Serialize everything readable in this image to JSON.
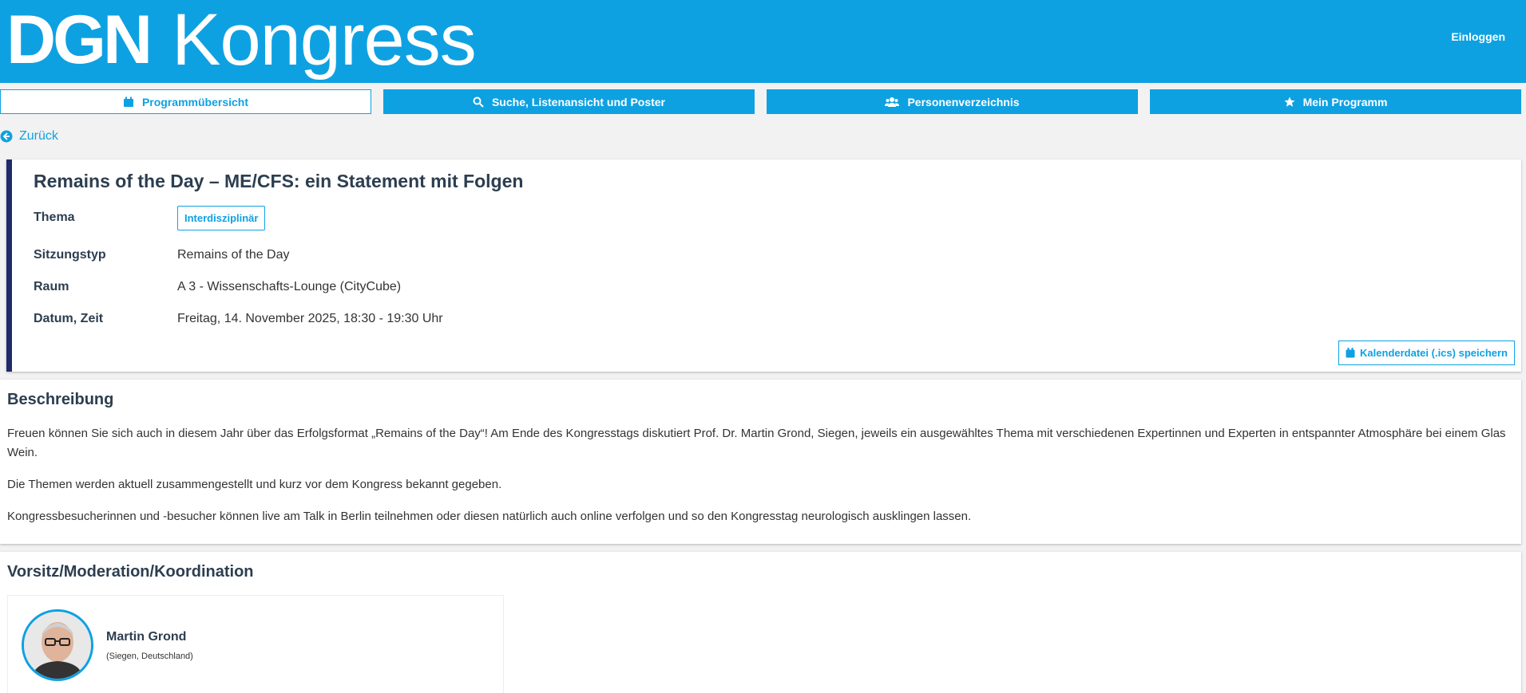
{
  "header": {
    "logo_dgn": "DGN",
    "logo_kongress": "Kongress",
    "login_label": "Einloggen"
  },
  "nav": {
    "items": [
      {
        "label": "Programmübersicht",
        "icon": "calendar-icon",
        "active": true
      },
      {
        "label": "Suche, Listenansicht und Poster",
        "icon": "search-icon",
        "active": false
      },
      {
        "label": "Personenverzeichnis",
        "icon": "users-icon",
        "active": false
      },
      {
        "label": "Mein Programm",
        "icon": "star-icon",
        "active": false
      }
    ]
  },
  "back_label": "Zurück",
  "session": {
    "title": "Remains of the Day – ME/CFS: ein Statement mit Folgen",
    "thema_label": "Thema",
    "thema_value": "Interdisziplinär",
    "sitzungstyp_label": "Sitzungstyp",
    "sitzungstyp_value": "Remains of the Day",
    "raum_label": "Raum",
    "raum_value": "A 3 - Wissenschafts-Lounge (CityCube)",
    "datum_label": "Datum, Zeit",
    "datum_value": "Freitag, 14. November 2025, 18:30 - 19:30 Uhr",
    "ics_label": "Kalenderdatei (.ics) speichern"
  },
  "description": {
    "heading": "Beschreibung",
    "p1": "Freuen können Sie sich auch in diesem Jahr über das Erfolgsformat „Remains of the Day“! Am Ende des Kongresstags diskutiert Prof. Dr. Martin Grond, Siegen, jeweils ein ausgewähltes Thema mit verschiedenen Expertinnen und Experten in entspannter Atmosphäre bei einem Glas Wein.",
    "p2": "Die Themen werden aktuell zusammengestellt und kurz vor dem Kongress bekannt gegeben.",
    "p3": "Kongressbesucherinnen und -besucher können live am Talk in Berlin teilnehmen oder diesen natürlich auch online verfolgen und so den Kongresstag neurologisch ausklingen lassen."
  },
  "moderation": {
    "heading": "Vorsitz/Moderation/Koordination",
    "person_name": "Martin Grond",
    "person_location": "(Siegen, Deutschland)"
  },
  "colors": {
    "accent": "#0ea1e2",
    "session_border": "#1f2a6b",
    "text": "#2c3e50"
  }
}
